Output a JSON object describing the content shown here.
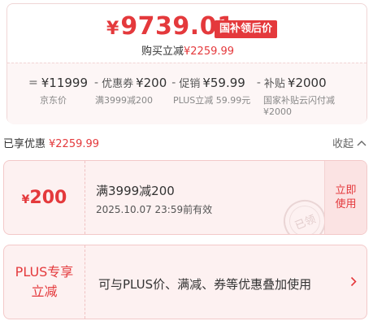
{
  "price": {
    "currency": "¥",
    "amount": "9739.01",
    "badge": "国补领后价",
    "buy_label": "购买立减",
    "buy_amount": "¥2259.99"
  },
  "formula": {
    "equals": "=",
    "base_price": "¥11999",
    "base_label": "京东价",
    "minus1": "-",
    "coupon_term": "优惠券",
    "coupon_value": "¥200",
    "coupon_label": "满3999减200",
    "minus2": "-",
    "promo_term": "促销",
    "promo_value": "¥59.99",
    "promo_label": "PLUS立减 59.99元",
    "minus3": "-",
    "subsidy_term": "补贴",
    "subsidy_value": "¥2000",
    "subsidy_label_1": "国家补贴云闪付减",
    "subsidy_label_2": "¥2000"
  },
  "discount_section": {
    "label": "已享优惠",
    "amount": "¥2259.99",
    "collapse": "收起"
  },
  "coupon": {
    "currency": "¥",
    "amount": "200",
    "title": "满3999减200",
    "expiry": "2025.10.07 23:59前有效",
    "action_line1": "立即",
    "action_line2": "使用",
    "stamp": "已领"
  },
  "plus": {
    "label_line1": "PLUS专享",
    "label_line2": "立减",
    "description": "可与PLUS价、满减、券等优惠叠加使用"
  },
  "colors": {
    "accent": "#e4393c",
    "card_bg": "#fdf1f1"
  }
}
